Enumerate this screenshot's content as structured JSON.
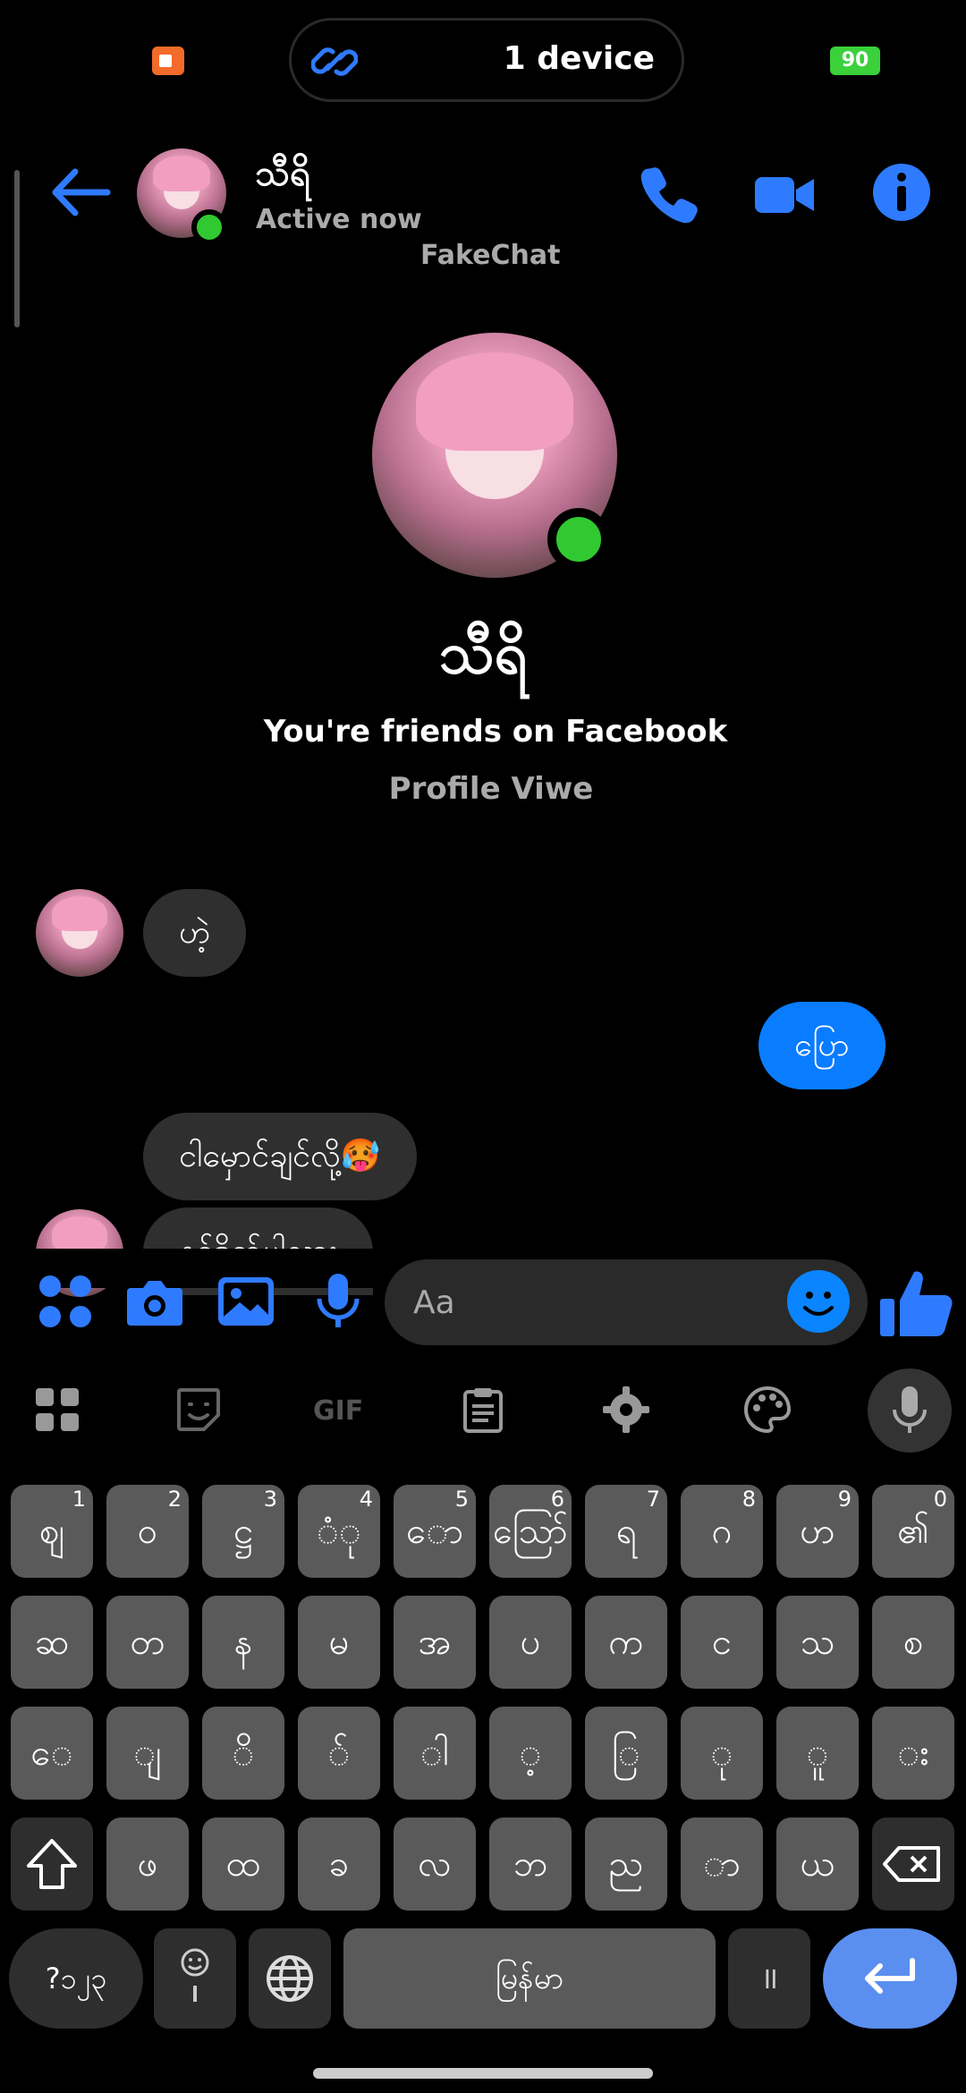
{
  "status": {
    "island_text": "1 device",
    "battery": "90"
  },
  "header": {
    "name": "သီရိ",
    "status": "Active now",
    "app_label": "FakeChat"
  },
  "profile": {
    "name": "သီရိ",
    "friends_text": "You're friends on Facebook",
    "view_link": "Profile Viwe"
  },
  "messages": [
    {
      "side": "in",
      "text": "ဟဲ့"
    },
    {
      "side": "out",
      "text": "ပြော"
    },
    {
      "side": "in",
      "text": "ငါမှောင်ချင်လို့🥵"
    },
    {
      "side": "in",
      "text": "နင်ဒိုက်ပါလား"
    }
  ],
  "composer": {
    "placeholder": "Aa"
  },
  "keyboard": {
    "toolbar_gif": "GIF",
    "row1": [
      {
        "k": "ဈ",
        "n": "1"
      },
      {
        "k": "ဝ",
        "n": "2"
      },
      {
        "k": "ဋ္ဌ",
        "n": "3"
      },
      {
        "k": "ံု",
        "n": "4"
      },
      {
        "k": "ော",
        "n": "5"
      },
      {
        "k": "ဪ",
        "n": "6"
      },
      {
        "k": "ရ",
        "n": "7"
      },
      {
        "k": "ဂ",
        "n": "8"
      },
      {
        "k": "ဟ",
        "n": "9"
      },
      {
        "k": "၏",
        "n": "0"
      }
    ],
    "row2": [
      "ဆ",
      "တ",
      "န",
      "မ",
      "အ",
      "ပ",
      "က",
      "င",
      "သ",
      "စ"
    ],
    "row3": [
      "ေ",
      "ျ",
      "ိ",
      "်",
      "ါ",
      "့",
      "ြ",
      "ု",
      "ူ",
      "း"
    ],
    "row4": [
      "ဖ",
      "ထ",
      "ခ",
      "လ",
      "ဘ",
      "ည",
      "ာ",
      "ယ"
    ],
    "sym_label": "?၁၂၃",
    "space_label": "မြန်မာ",
    "pipe_label": "॥"
  }
}
